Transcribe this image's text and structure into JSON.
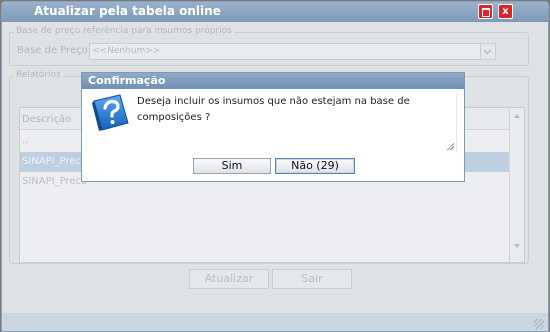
{
  "window": {
    "title": "Atualizar pela tabela online"
  },
  "form": {
    "fieldset_label": "Base de preço referência para insumos próprios",
    "base_label": "Base de Preço:",
    "base_value": "<<Nenhum>>"
  },
  "reports": {
    "fieldset_label": "Relatórios",
    "column_header": "Descrição",
    "rows": [
      "..",
      "SINAPI_Preco",
      "SINAPI_Preco"
    ]
  },
  "buttons": {
    "update": "Atualizar",
    "exit": "Sair"
  },
  "dialog": {
    "title": "Confirmação",
    "message": "Deseja incluir os insumos que não estejam na base de composições ?",
    "yes": "Sim",
    "no": "Não (29)"
  }
}
